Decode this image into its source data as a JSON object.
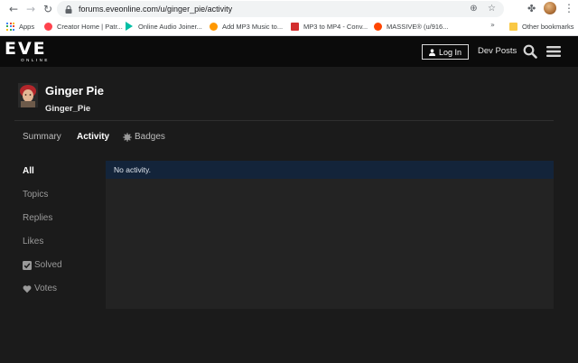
{
  "browser": {
    "url": "forums.eveonline.com/u/ginger_pie/activity",
    "icons": [
      "back-icon",
      "forward-icon",
      "reload-icon",
      "lock-icon",
      "zoom-icon",
      "star-icon",
      "extensions-icon",
      "menu-icon"
    ],
    "bookmarks": [
      {
        "label": "Apps"
      },
      {
        "label": "Creator Home | Patr..."
      },
      {
        "label": "Online Audio Joiner..."
      },
      {
        "label": "Add MP3 Music to..."
      },
      {
        "label": "MP3 to MP4 - Conv..."
      },
      {
        "label": "MASSIVE® (u/916..."
      }
    ],
    "more_bookmarks": "»",
    "other_bookmarks": "Other bookmarks"
  },
  "header": {
    "logo_mark": "EVE",
    "logo_sub": "ONLINE",
    "login_label": "Log In",
    "dev_posts_label": "Dev Posts"
  },
  "profile": {
    "name": "Ginger Pie",
    "username": "Ginger_Pie"
  },
  "tabs": [
    {
      "label": "Summary",
      "active": false
    },
    {
      "label": "Activity",
      "active": true
    },
    {
      "label": "Badges",
      "active": false
    }
  ],
  "sidebar": {
    "items": [
      {
        "label": "All",
        "active": true
      },
      {
        "label": "Topics"
      },
      {
        "label": "Replies"
      },
      {
        "label": "Likes"
      },
      {
        "label": "Solved",
        "icon": "checkbox-icon"
      },
      {
        "label": "Votes",
        "icon": "heart-icon"
      }
    ]
  },
  "content": {
    "notice": "No activity."
  },
  "colors": {
    "page_bg": "#1b1b1b",
    "header_bg": "#0b0b0b",
    "notice_bg": "#13243a",
    "panel_bg": "#232323"
  }
}
